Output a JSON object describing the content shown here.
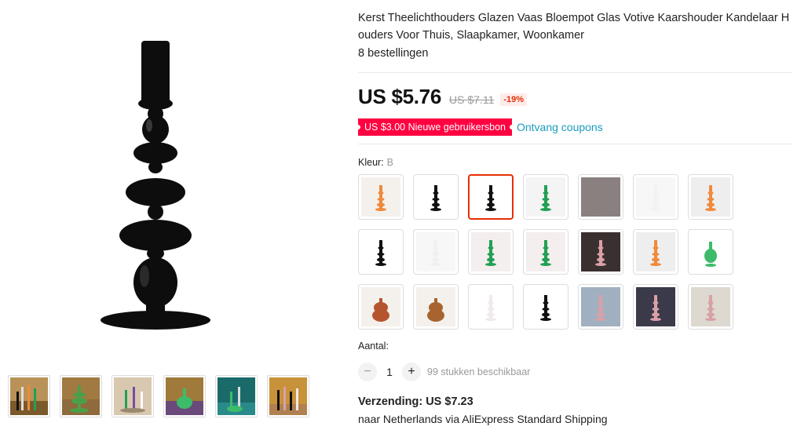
{
  "product": {
    "title": "Kerst Theelichthouders Glazen Vaas Bloempot Glas Votive Kaarshouder Kandelaar Houders Voor Thuis, Slaapkamer, Woonkamer",
    "orders": "8 bestellingen"
  },
  "pricing": {
    "price": "US $5.76",
    "original_price": "US $7.11",
    "discount": "-19%"
  },
  "coupon": {
    "badge": "US $3.00 Nieuwe gebruikersbon",
    "link": "Ontvang coupons"
  },
  "color": {
    "label": "Kleur:",
    "selected": "B",
    "options": [
      {
        "hue": "#f08a3c"
      },
      {
        "hue": "#111111"
      },
      {
        "hue": "#111111"
      },
      {
        "hue": "#22a055"
      },
      {
        "hue": "#8a7f7f"
      },
      {
        "hue": "#f2f2f2"
      },
      {
        "hue": "#f08a3c"
      },
      {
        "hue": "#111111"
      },
      {
        "hue": "#f0f0f0"
      },
      {
        "hue": "#22a055"
      },
      {
        "hue": "#22a055"
      },
      {
        "hue": "#d9a0a8"
      },
      {
        "hue": "#f08a3c"
      },
      {
        "hue": "#3dbb6a"
      },
      {
        "hue": "#b5552e"
      },
      {
        "hue": "#a8642e"
      },
      {
        "hue": "#f0eaea"
      },
      {
        "hue": "#111111"
      },
      {
        "hue": "#d9a0a8"
      },
      {
        "hue": "#d9a0a8"
      },
      {
        "hue": "#d9a0a8"
      }
    ]
  },
  "quantity": {
    "label": "Aantal:",
    "minus": "−",
    "value": "1",
    "plus": "+",
    "available": "99 stukken beschikbaar"
  },
  "shipping": {
    "title": "Verzending: US $7.23",
    "detail": "naar Netherlands via AliExpress Standard Shipping"
  },
  "colors": {
    "accent": "#ff0040",
    "link": "#1a9bbf",
    "selected_border": "#e62e04"
  }
}
